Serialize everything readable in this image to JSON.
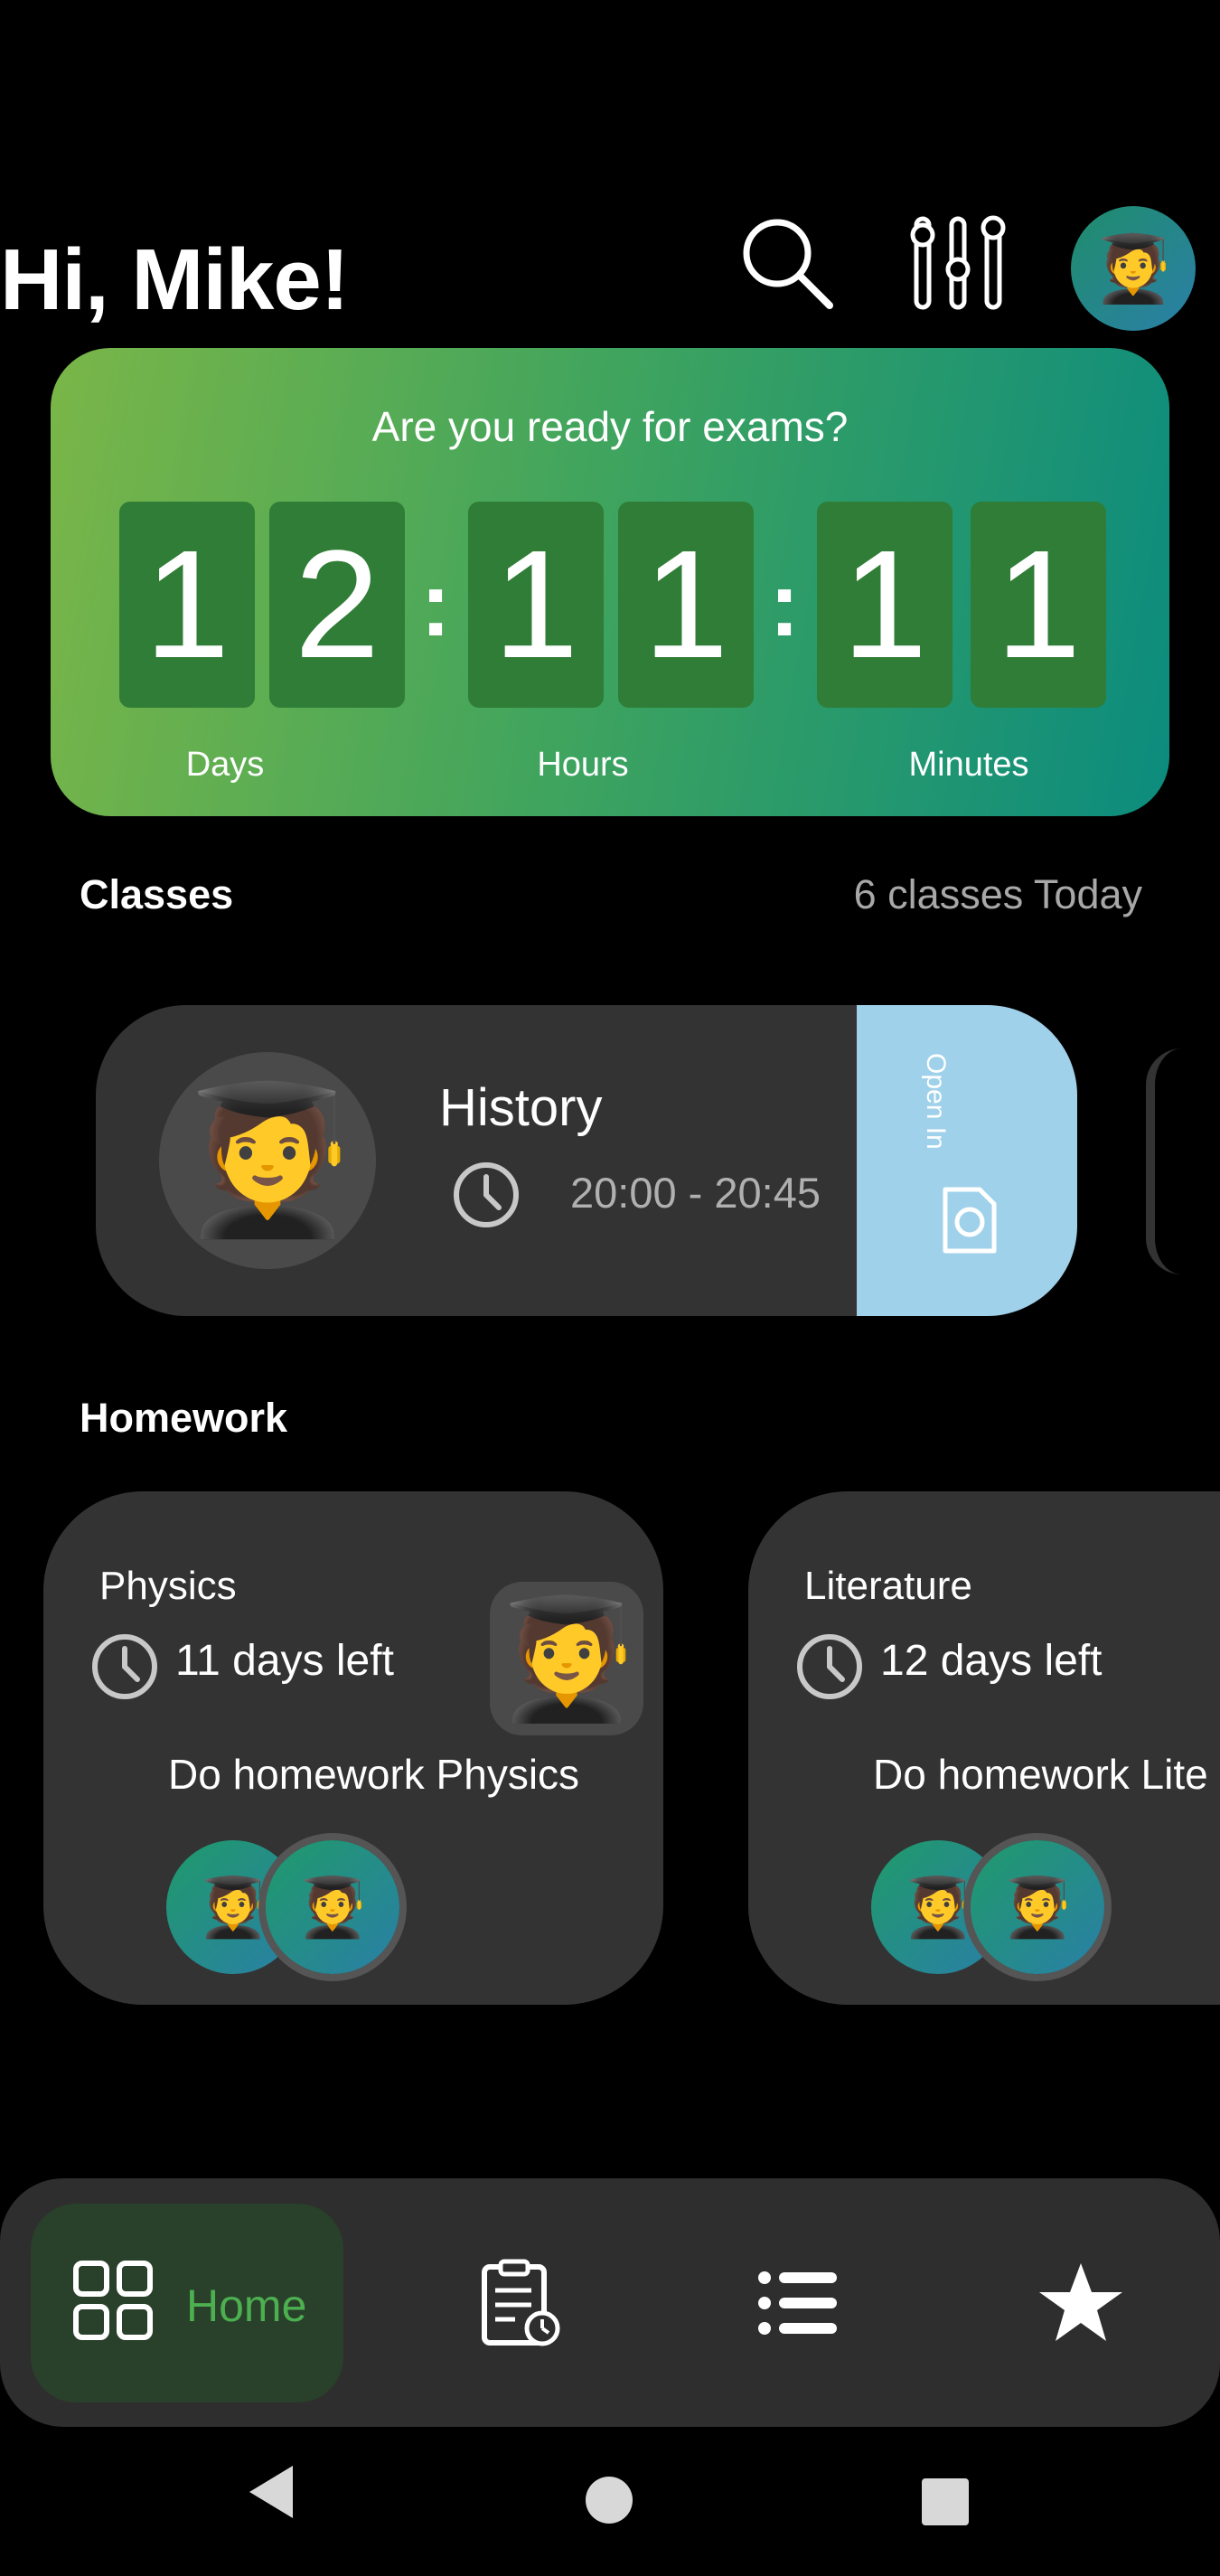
{
  "header": {
    "greeting": "Hi, Mike!",
    "search_icon": "search-icon",
    "filter_icon": "sliders-icon",
    "avatar": "🧑‍🎓"
  },
  "countdown": {
    "title": "Are you ready for exams?",
    "digits": [
      "1",
      "2",
      "1",
      "1",
      "1",
      "1"
    ],
    "separator": ":",
    "labels": {
      "days": "Days",
      "hours": "Hours",
      "minutes": "Minutes"
    },
    "gradient_colors": [
      "#7ab648",
      "#0c8c7e"
    ],
    "digit_bg": "#2f7d36"
  },
  "classes": {
    "title": "Classes",
    "meta": "6 classes Today",
    "items": [
      {
        "name": "History",
        "time": "20:00 - 20:45",
        "avatar": "🧑‍🎓",
        "action": "Open In",
        "action_icon": "camera-icon"
      }
    ]
  },
  "homework": {
    "title": "Homework",
    "items": [
      {
        "subject": "Physics",
        "due": "11 days left",
        "task": "Do homework Physics",
        "photo": "🧑‍🎓",
        "participants": [
          "🧑‍🎓",
          "🧑‍🎓"
        ]
      },
      {
        "subject": "Literature",
        "due": "12 days left",
        "task": "Do homework Lite",
        "participants": [
          "🧑‍🎓",
          "🧑‍🎓"
        ]
      }
    ]
  },
  "bottom_nav": {
    "items": [
      {
        "label": "Home",
        "icon": "grid-icon",
        "active": true
      },
      {
        "label": "",
        "icon": "clipboard-clock-icon",
        "active": false
      },
      {
        "label": "",
        "icon": "list-icon",
        "active": false
      },
      {
        "label": "",
        "icon": "star-icon",
        "active": false
      }
    ],
    "active_color": "#4caf50"
  },
  "system_nav": {
    "back_icon": "back-triangle-icon",
    "home_icon": "home-circle-icon",
    "recents_icon": "recents-square-icon"
  }
}
